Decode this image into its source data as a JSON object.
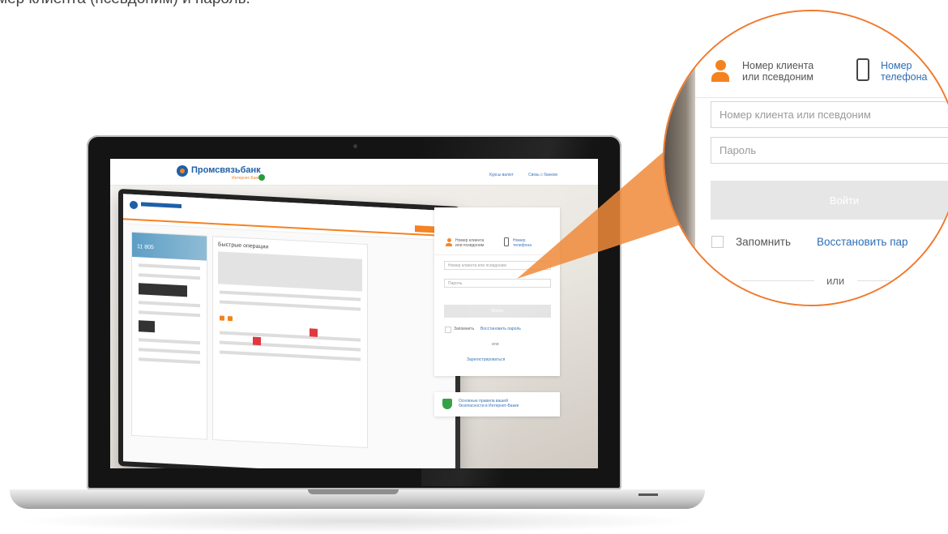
{
  "caption": "мер клиента (псевдоним) и пароль.",
  "colors": {
    "brand_blue": "#1f5fa8",
    "brand_orange": "#f58220",
    "link_blue": "#2d6db4",
    "callout_orange": "#f07a2c"
  },
  "site": {
    "logo": "Промсвязьбанк",
    "logo_sub": "Интернет-Банк",
    "header_links": [
      "Курсы валют",
      "Связь с банком"
    ]
  },
  "login": {
    "tabs": [
      {
        "label_line1": "Номер клиента",
        "label_line2": "или псевдоним",
        "icon": "person-icon",
        "active": true
      },
      {
        "label_line1": "Номер",
        "label_line2": "телефона",
        "icon": "phone-icon",
        "active": false
      }
    ],
    "client_placeholder": "Номер клиента или псевдоним",
    "password_placeholder": "Пароль",
    "submit_label": "Войти",
    "remember_label": "Запомнить",
    "restore_link": "Восстановить пароль",
    "or_label": "или",
    "register_link": "Зарегистрироваться"
  },
  "magnified": {
    "tab1_line1": "Номер клиента",
    "tab1_line2": "или псевдоним",
    "tab2_line1": "Номер",
    "tab2_line2": "телефона",
    "client_placeholder": "Номер клиента или псевдоним",
    "password_placeholder": "Пароль",
    "submit_label": "Войти",
    "remember_label": "Запомнить",
    "restore_link": "Восстановить пар",
    "or_label": "или"
  },
  "security_banner": {
    "line1": "Основные правила вашей",
    "line2": "безопасности в Интернет-Банке"
  },
  "inner_app": {
    "quick_ops_title": "Быстрые операции",
    "balance_hint": "11 805"
  }
}
